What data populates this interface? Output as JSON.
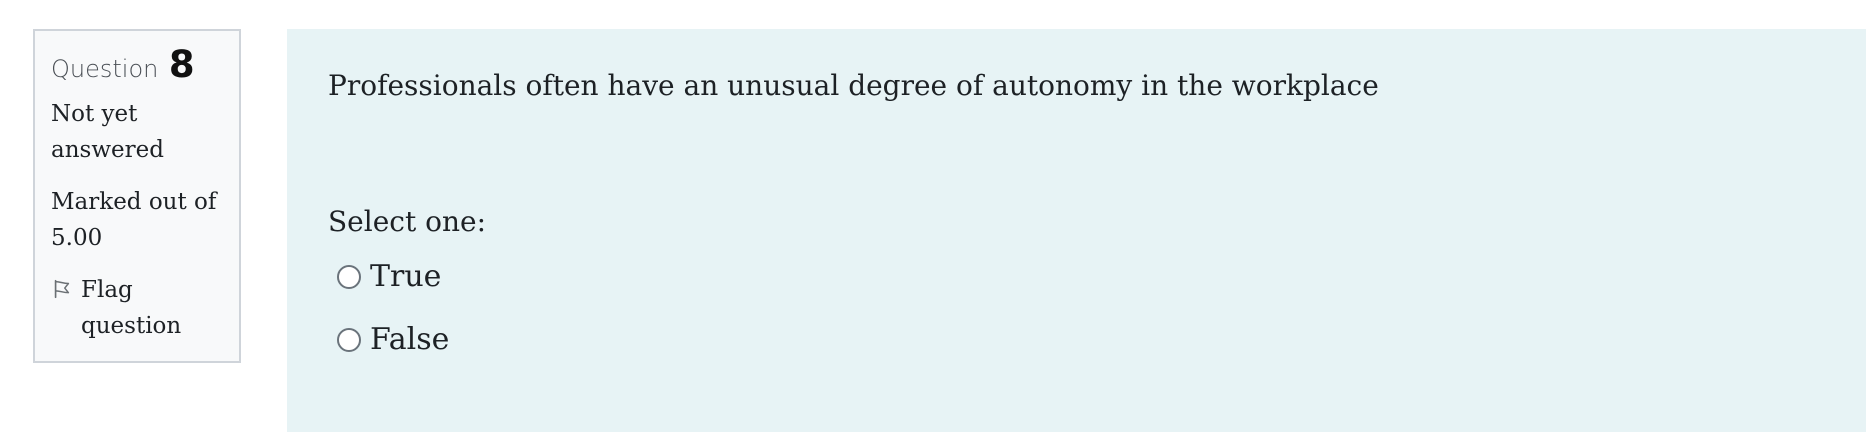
{
  "question": {
    "number": "8",
    "label_word": "Question",
    "status": "Not yet answered",
    "marks": "Marked out of 5.00",
    "flag_label": "Flag question",
    "text": "Professionals often have an unusual degree of autonomy in the workplace",
    "prompt": "Select one:",
    "options": [
      {
        "label": "True",
        "selected": false
      },
      {
        "label": "False",
        "selected": false
      }
    ]
  },
  "theme": {
    "content_bg": "#e7f3f5",
    "info_bg": "#f8f9fa",
    "info_border": "#cfd4da",
    "text": "#1d2125"
  },
  "icons": {
    "flag": "flag-icon"
  }
}
